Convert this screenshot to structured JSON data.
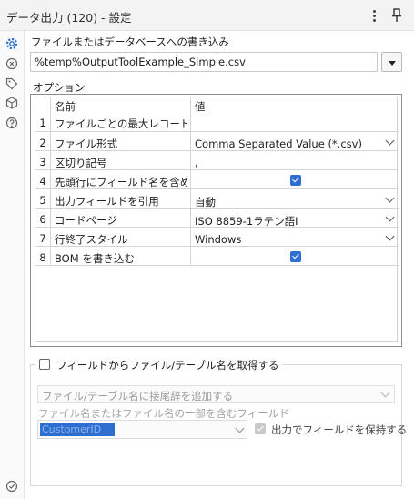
{
  "window": {
    "title": "データ出力 (120) - 設定",
    "more_icon": "kebab-menu-icon",
    "pin_icon": "pin-icon"
  },
  "siderail": {
    "items": [
      {
        "icon": "gear-icon",
        "active": true
      },
      {
        "icon": "connection-icon",
        "active": false
      },
      {
        "icon": "tag-icon",
        "active": false
      },
      {
        "icon": "cube-icon",
        "active": false
      },
      {
        "icon": "help-icon",
        "active": false
      }
    ],
    "bottom_icon": "check-circle-icon"
  },
  "output": {
    "label": "ファイルまたはデータベースへの書き込み",
    "path_value": "%temp%OutputToolExample_Simple.csv"
  },
  "options": {
    "label": "オプション",
    "columns": [
      "名前",
      "値"
    ],
    "rows": [
      {
        "num": "1",
        "name": "ファイルごとの最大レコード数",
        "value": "",
        "kind": "text"
      },
      {
        "num": "2",
        "name": "ファイル形式",
        "value": "Comma Separated Value (*.csv)",
        "kind": "dropdown"
      },
      {
        "num": "3",
        "name": "区切り記号",
        "value": ",",
        "kind": "text"
      },
      {
        "num": "4",
        "name": "先頭行にフィールド名を含め…",
        "value": "",
        "kind": "checkbox",
        "checked": true
      },
      {
        "num": "5",
        "name": "出力フィールドを引用",
        "value": "自動",
        "kind": "dropdown"
      },
      {
        "num": "6",
        "name": "コードページ",
        "value": "ISO 8859-1ラテン語I",
        "kind": "dropdown"
      },
      {
        "num": "7",
        "name": "行終了スタイル",
        "value": "Windows",
        "kind": "dropdown"
      },
      {
        "num": "8",
        "name": "BOM を書き込む",
        "value": "",
        "kind": "checkbox",
        "checked": true
      }
    ]
  },
  "filename_from_field": {
    "label": "フィールドからファイル/テーブル名を取得する",
    "checked": false,
    "mode_value": "ファイル/テーブル名に接尾辞を追加する",
    "field_label": "ファイル名またはファイル名の一部を含むフィールド",
    "field_value": "CustomerID",
    "keep_label": "出力でフィールドを保持する",
    "keep_checked": true
  },
  "colors": {
    "accent": "#2f6fd1",
    "selection": "#2d6fd0",
    "disabled_text": "#a3a3a3"
  }
}
